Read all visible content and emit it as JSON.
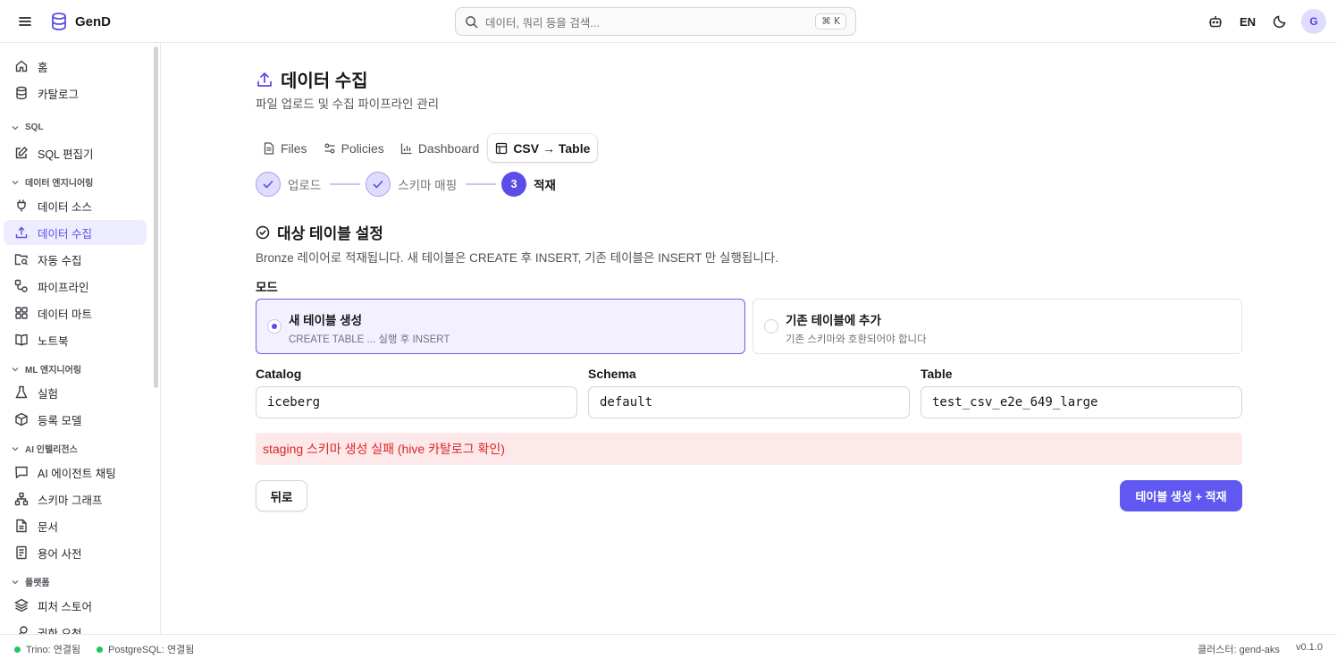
{
  "app": {
    "name": "GenD"
  },
  "search": {
    "placeholder": "데이터, 쿼리 등을 검색...",
    "shortcut": "⌘ K"
  },
  "header": {
    "lang": "EN",
    "avatar_initial": "G"
  },
  "sidebar": {
    "items_top": [
      {
        "label": "홈",
        "icon": "home-icon"
      },
      {
        "label": "카탈로그",
        "icon": "database-icon"
      }
    ],
    "sections": [
      {
        "title": "SQL",
        "items": [
          {
            "label": "SQL 편집기",
            "icon": "edit-icon"
          }
        ]
      },
      {
        "title": "데이터 엔지니어링",
        "items": [
          {
            "label": "데이터 소스",
            "icon": "plug-icon"
          },
          {
            "label": "데이터 수집",
            "icon": "upload-icon",
            "active": true
          },
          {
            "label": "자동 수집",
            "icon": "folder-search-icon"
          },
          {
            "label": "파이프라인",
            "icon": "pipeline-icon"
          },
          {
            "label": "데이터 마트",
            "icon": "grid-icon"
          },
          {
            "label": "노트북",
            "icon": "book-icon"
          }
        ]
      },
      {
        "title": "ML 엔지니어링",
        "items": [
          {
            "label": "실험",
            "icon": "flask-icon"
          },
          {
            "label": "등록 모델",
            "icon": "cube-icon"
          }
        ]
      },
      {
        "title": "AI 인텔리전스",
        "items": [
          {
            "label": "AI 에이전트 채팅",
            "icon": "chat-icon"
          },
          {
            "label": "스키마 그래프",
            "icon": "graph-icon"
          },
          {
            "label": "문서",
            "icon": "document-icon"
          },
          {
            "label": "용어 사전",
            "icon": "glossary-icon"
          }
        ]
      },
      {
        "title": "플랫폼",
        "items": [
          {
            "label": "피처 스토어",
            "icon": "layers-icon"
          },
          {
            "label": "권한 요청",
            "icon": "key-icon"
          }
        ]
      }
    ]
  },
  "page": {
    "title": "데이터 수집",
    "subtitle": "파일 업로드 및 수집 파이프라인 관리"
  },
  "tabs": [
    {
      "label": "Files",
      "icon": "file-icon"
    },
    {
      "label": "Policies",
      "icon": "policy-icon"
    },
    {
      "label": "Dashboard",
      "icon": "chart-icon"
    },
    {
      "label": "CSV → Table",
      "icon": "table-icon",
      "active": true
    }
  ],
  "stepper": [
    {
      "label": "업로드",
      "state": "done"
    },
    {
      "label": "스키마 매핑",
      "state": "done"
    },
    {
      "label": "적재",
      "number": "3",
      "state": "current"
    }
  ],
  "section": {
    "title": "대상 테이블 설정",
    "description": "Bronze 레이어로 적재됩니다. 새 테이블은 CREATE 후 INSERT, 기존 테이블은 INSERT 만 실행됩니다."
  },
  "mode": {
    "label": "모드",
    "options": [
      {
        "title": "새 테이블 생성",
        "desc": "CREATE TABLE ... 실행 후 INSERT",
        "selected": true
      },
      {
        "title": "기존 테이블에 추가",
        "desc": "기존 스키마와 호환되어야 합니다",
        "selected": false
      }
    ]
  },
  "fields": {
    "catalog": {
      "label": "Catalog",
      "value": "iceberg"
    },
    "schema": {
      "label": "Schema",
      "value": "default"
    },
    "table": {
      "label": "Table",
      "value": "test_csv_e2e_649_large"
    }
  },
  "error": "staging 스키마 생성 실패 (hive 카탈로그 확인)",
  "buttons": {
    "back": "뒤로",
    "submit": "테이블 생성 + 적재"
  },
  "footer": {
    "trino": "Trino: 연결됨",
    "postgres": "PostgreSQL: 연결됨",
    "cluster": "클러스터: gend-aks",
    "version": "v0.1.0"
  },
  "colors": {
    "accent": "#5b4ee6",
    "button": "#6058f0",
    "error_bg": "#fde8ea",
    "error_text": "#dc2626",
    "status_ok": "#22c55e"
  }
}
